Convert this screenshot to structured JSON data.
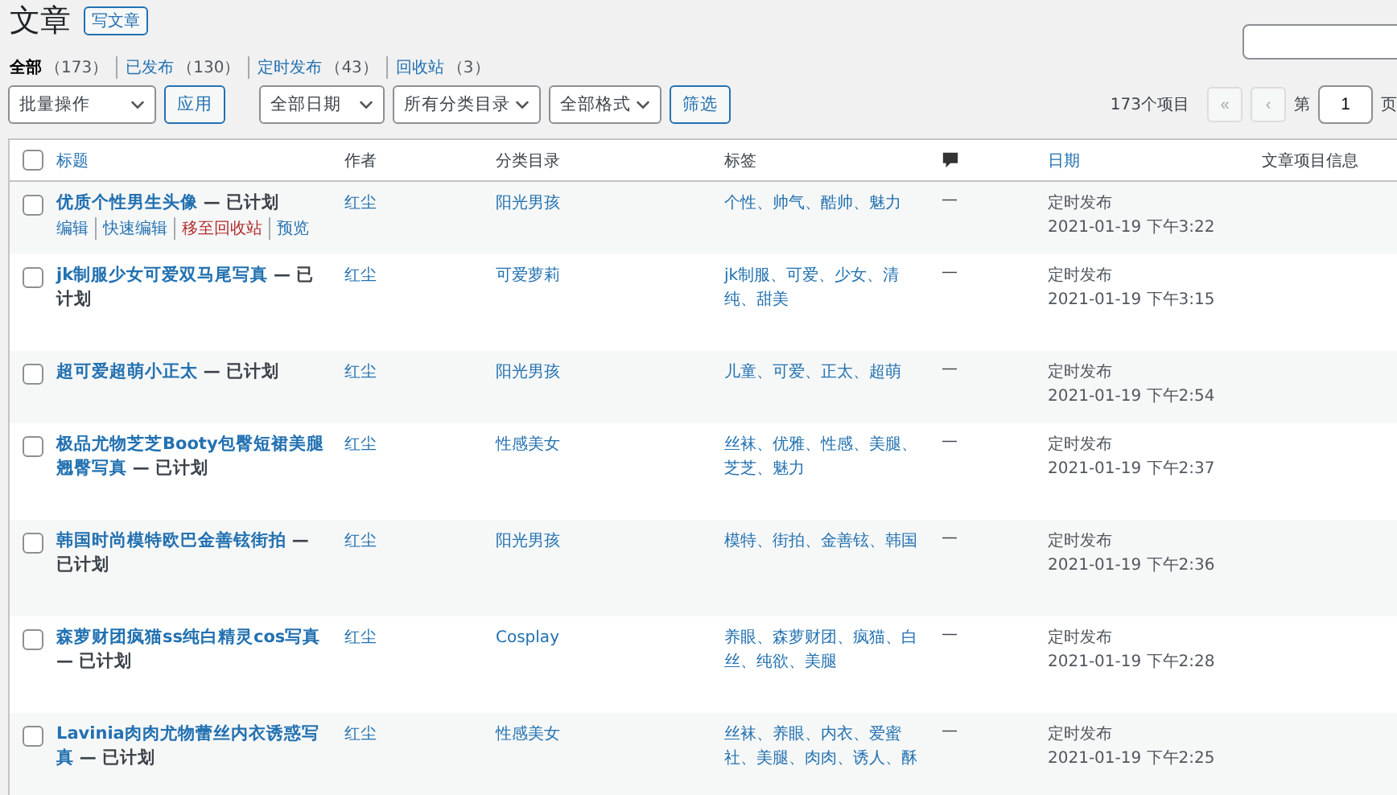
{
  "page": {
    "title": "文章",
    "add_button": "写文章"
  },
  "status_filters": [
    {
      "label": "全部",
      "count": "（173）",
      "selected": true
    },
    {
      "label": "已发布",
      "count": "（130）",
      "selected": false
    },
    {
      "label": "定时发布",
      "count": "（43）",
      "selected": false
    },
    {
      "label": "回收站",
      "count": "（3）",
      "selected": false
    }
  ],
  "toolbar": {
    "bulk_action": "批量操作",
    "apply_button": "应用",
    "date_filter": "全部日期",
    "category_filter": "所有分类目录",
    "format_filter": "全部格式",
    "filter_button": "筛选"
  },
  "pagination": {
    "item_count": "173个项目",
    "first_button": {
      "label": "«",
      "disabled": true
    },
    "prev_button": {
      "label": "‹",
      "disabled": true
    },
    "page_prefix": "第",
    "current_page": "1",
    "page_suffix": "页"
  },
  "table": {
    "header_checked": false,
    "columns": [
      {
        "kind": "text",
        "label": "标题",
        "sortable": true
      },
      {
        "kind": "text",
        "label": "作者",
        "sortable": false
      },
      {
        "kind": "text",
        "label": "分类目录",
        "sortable": false
      },
      {
        "kind": "text",
        "label": "标签",
        "sortable": false
      },
      {
        "kind": "comments"
      },
      {
        "kind": "text",
        "label": "日期",
        "sortable": true
      },
      {
        "kind": "text",
        "label": "文章项目信息",
        "sortable": false
      }
    ],
    "rows": [
      {
        "checked": false,
        "title": "优质个性男生头像",
        "state": "— 已计划",
        "actions": [
          {
            "label": "编辑",
            "kind": "normal"
          },
          {
            "label": "快速编辑",
            "kind": "normal"
          },
          {
            "label": "移至回收站",
            "kind": "trash"
          },
          {
            "label": "预览",
            "kind": "normal"
          }
        ],
        "author": "红尘",
        "category": "阳光男孩",
        "tags": "个性、帅气、酷帅、魅力",
        "comments": "—",
        "date_status": "定时发布",
        "date": "2021-01-19 下午3:22"
      },
      {
        "checked": false,
        "title": "jk制服少女可爱双马尾写真",
        "state": "— 已计划",
        "author": "红尘",
        "category": "可爱萝莉",
        "tags": "jk制服、可爱、少女、清纯、甜美",
        "comments": "—",
        "date_status": "定时发布",
        "date": "2021-01-19 下午3:15"
      },
      {
        "checked": false,
        "title": "超可爱超萌小正太",
        "state": "— 已计划",
        "author": "红尘",
        "category": "阳光男孩",
        "tags": "儿童、可爱、正太、超萌",
        "comments": "—",
        "date_status": "定时发布",
        "date": "2021-01-19 下午2:54"
      },
      {
        "checked": false,
        "title": "极品尤物芝芝Booty包臀短裙美腿翘臀写真",
        "state": "— 已计划",
        "author": "红尘",
        "category": "性感美女",
        "tags": "丝袜、优雅、性感、美腿、芝芝、魅力",
        "comments": "—",
        "date_status": "定时发布",
        "date": "2021-01-19 下午2:37"
      },
      {
        "checked": false,
        "title": "韩国时尚模特欧巴金善铉街拍",
        "state": "— 已计划",
        "author": "红尘",
        "category": "阳光男孩",
        "tags": "模特、街拍、金善铉、韩国",
        "comments": "—",
        "date_status": "定时发布",
        "date": "2021-01-19 下午2:36"
      },
      {
        "checked": false,
        "title": "森萝财团疯猫ss纯白精灵cos写真",
        "state": "— 已计划",
        "author": "红尘",
        "category": "Cosplay",
        "tags": "养眼、森萝财团、疯猫、白丝、纯欲、美腿",
        "comments": "—",
        "date_status": "定时发布",
        "date": "2021-01-19 下午2:28"
      },
      {
        "checked": false,
        "title": "Lavinia肉肉尤物蕾丝内衣诱惑写真",
        "state": "— 已计划",
        "author": "红尘",
        "category": "性感美女",
        "tags": "丝袜、养眼、内衣、爱蜜社、美腿、肉肉、诱人、酥",
        "comments": "—",
        "date_status": "定时发布",
        "date": "2021-01-19 下午2:25"
      }
    ]
  }
}
